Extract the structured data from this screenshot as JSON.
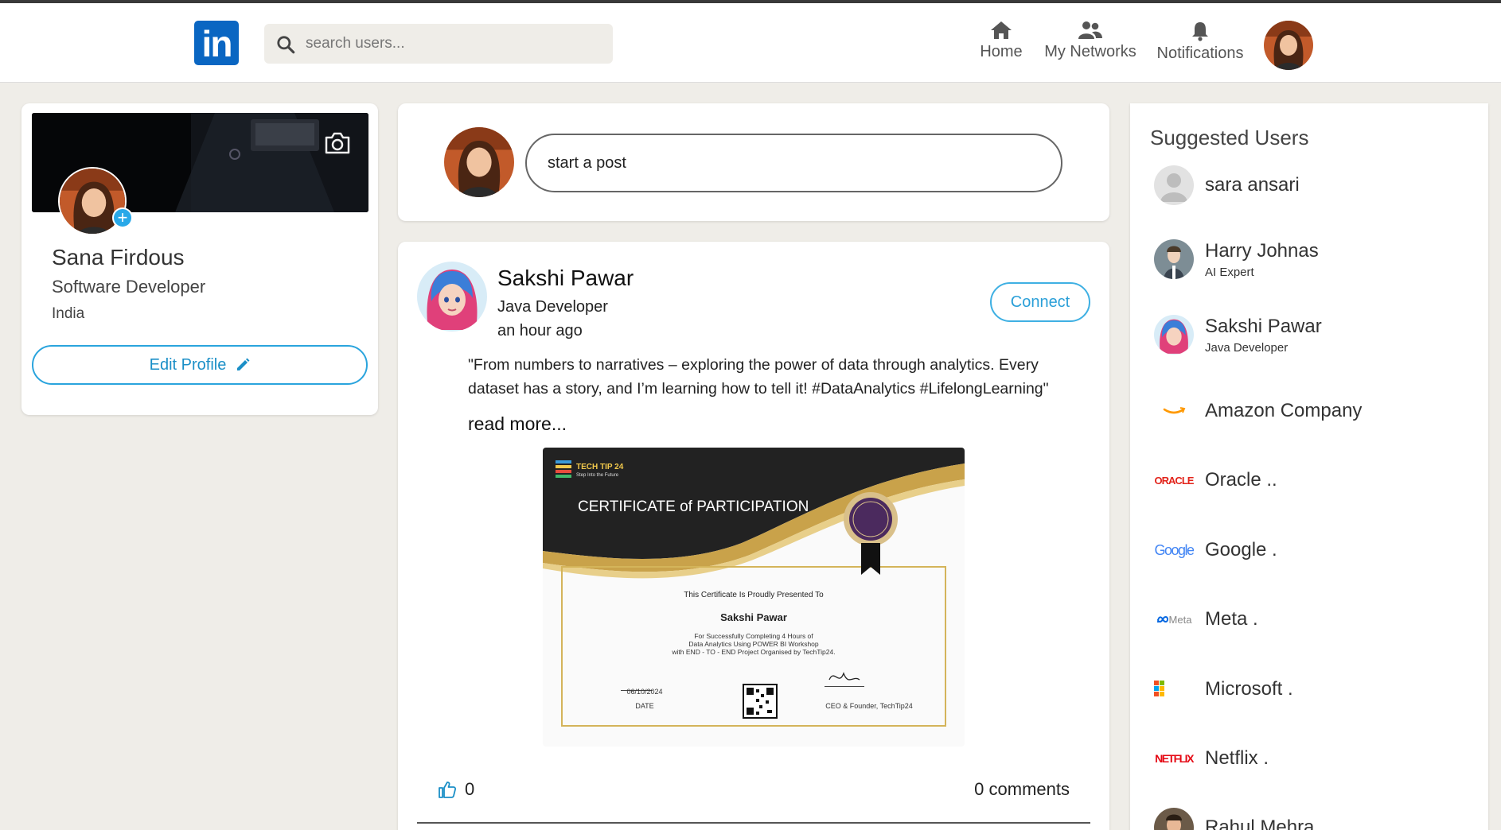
{
  "nav": {
    "logo_text": "in",
    "search_placeholder": "search users...",
    "items": [
      {
        "label": "Home",
        "icon": "home-icon"
      },
      {
        "label": "My Networks",
        "icon": "people-icon"
      },
      {
        "label": "Notifications",
        "icon": "bell-icon"
      }
    ],
    "accent": "#0a66c2"
  },
  "profile": {
    "name": "Sana Firdous",
    "title": "Software Developer",
    "location": "India",
    "edit_label": "Edit Profile"
  },
  "composer": {
    "placeholder": "start a post"
  },
  "post": {
    "author": "Sakshi Pawar",
    "role": "Java Developer",
    "time": "an hour ago",
    "connect_label": "Connect",
    "text": "\"From numbers to narratives – exploring the power of data through analytics. Every dataset has a story, and I’m learning how to tell it! #DataAnalytics #LifelongLearning\"",
    "read_more": "read more...",
    "likes": "0",
    "comments": "0 comments",
    "certificate": {
      "brand": "TECH TIP 24",
      "tagline": "Step Into the Future",
      "heading": "CERTIFICATE of PARTICIPATION",
      "presented": "This Certificate Is Proudly Presented To",
      "recipient": "Sakshi Pawar",
      "line1": "For Successfully Completing 4 Hours of",
      "line2": "Data Analytics Using POWER BI Workshop",
      "line3": "with END - TO - END Project Organised by TechTip24.",
      "date_value": "06/10/2024",
      "date_label": "DATE",
      "signer": "CEO & Founder, TechTip24"
    }
  },
  "suggested": {
    "title": "Suggested Users",
    "users": [
      {
        "name": "sara ansari",
        "subtitle": ""
      },
      {
        "name": "Harry Johnas",
        "subtitle": "AI Expert"
      },
      {
        "name": "Sakshi Pawar",
        "subtitle": "Java Developer"
      },
      {
        "name": "Amazon Company",
        "subtitle": ""
      },
      {
        "name": "Oracle ..",
        "subtitle": "",
        "logo": "ORACLE"
      },
      {
        "name": "Google .",
        "subtitle": "",
        "logo": "Google"
      },
      {
        "name": "Meta .",
        "subtitle": "",
        "logo": "Meta"
      },
      {
        "name": "Microsoft .",
        "subtitle": ""
      },
      {
        "name": "Netflix .",
        "subtitle": "",
        "logo": "NETFLIX"
      },
      {
        "name": "Rahul Mehra",
        "subtitle": ""
      }
    ]
  }
}
